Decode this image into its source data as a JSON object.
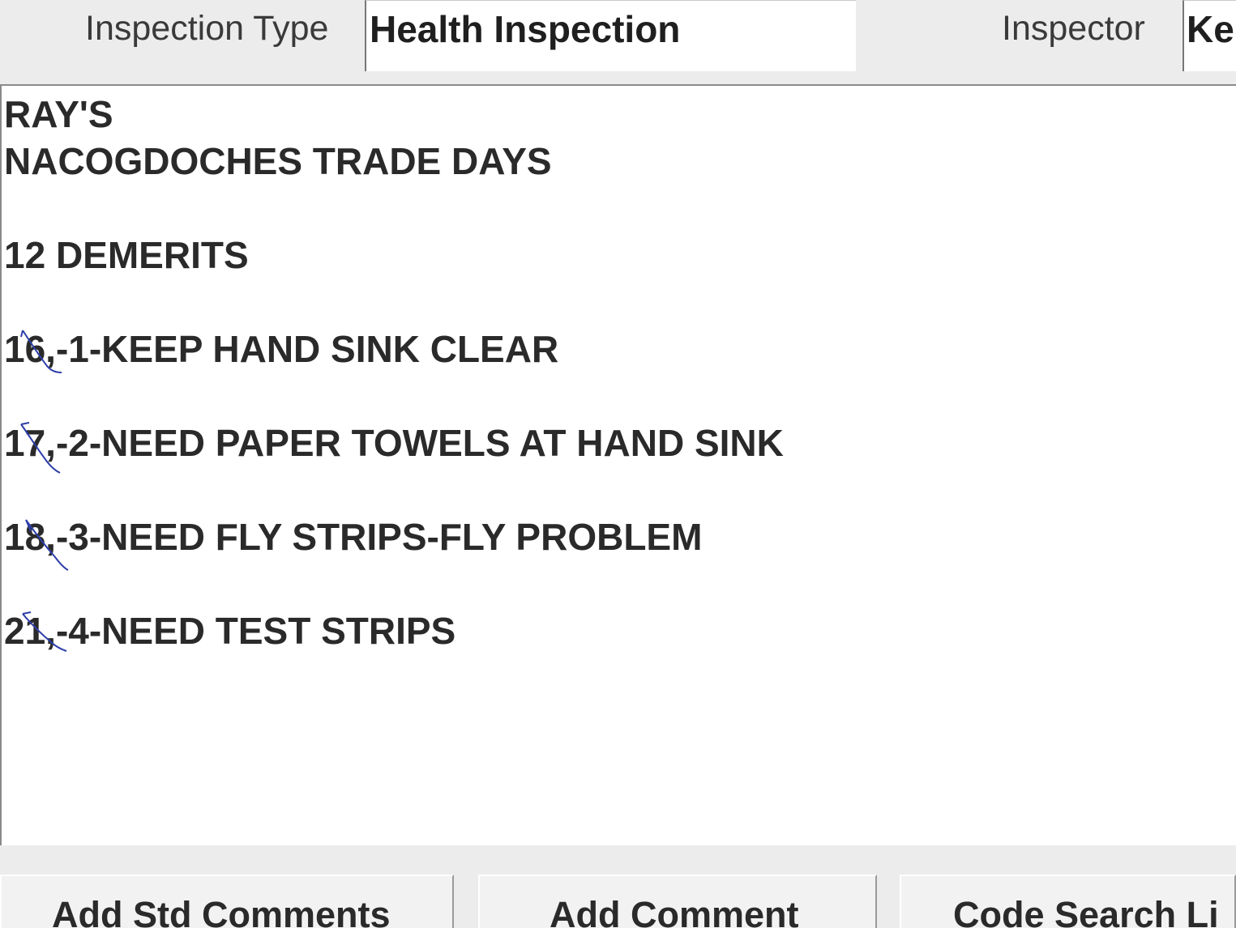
{
  "header": {
    "inspection_type_label": "Inspection Type",
    "inspection_type_value": "Health Inspection",
    "inspector_label": "Inspector",
    "inspector_value": "Ke"
  },
  "comments": {
    "lines": [
      "RAY'S",
      "NACOGDOCHES TRADE DAYS",
      "12 DEMERITS",
      "16,-1-KEEP HAND SINK CLEAR",
      "17,-2-NEED PAPER TOWELS AT HAND SINK",
      "18,-3-NEED FLY STRIPS-FLY PROBLEM",
      "21,-4-NEED TEST STRIPS"
    ]
  },
  "toolbar": {
    "add_std_comments": "Add Std Comments",
    "add_comment": "Add Comment",
    "code_search": "Code Search Li"
  },
  "colors": {
    "handwritten_mark": "#2d3ea8"
  }
}
